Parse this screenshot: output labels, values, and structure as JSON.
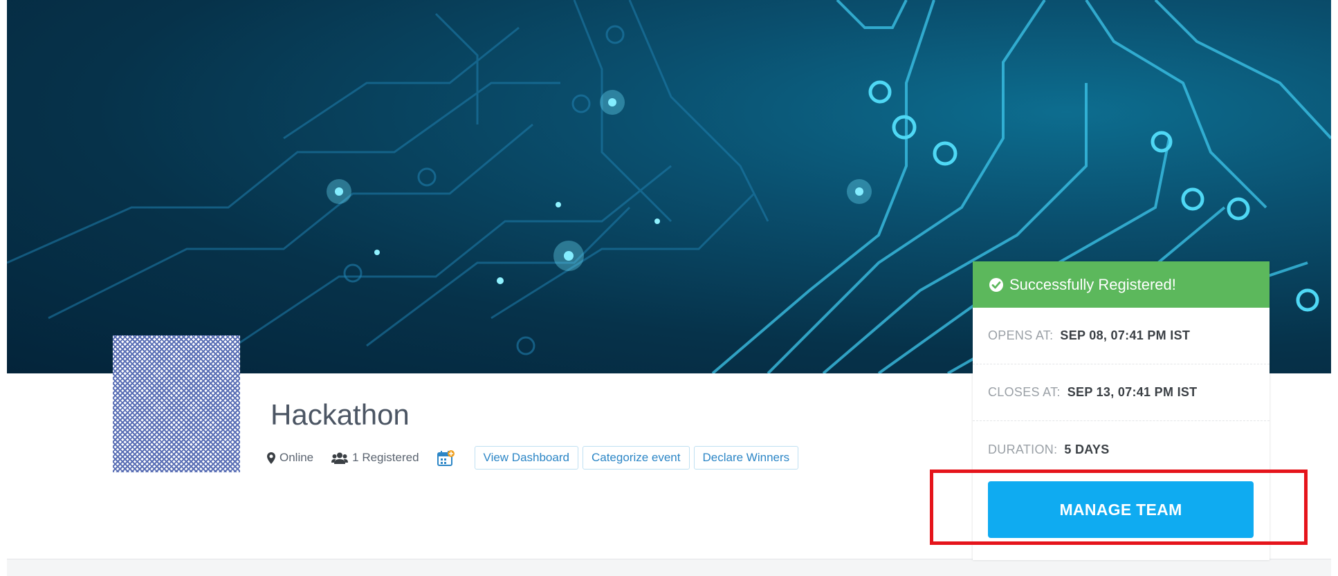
{
  "event": {
    "title": "Hackathon",
    "location": "Online",
    "registered": "1 Registered"
  },
  "actions": {
    "view_dashboard": "View Dashboard",
    "categorize_event": "Categorize event",
    "declare_winners": "Declare Winners"
  },
  "registration": {
    "status": "Successfully Registered!",
    "opens_label": "OPENS AT:",
    "opens_value": "SEP 08, 07:41 PM IST",
    "closes_label": "CLOSES AT:",
    "closes_value": "SEP 13, 07:41 PM IST",
    "duration_label": "DURATION:",
    "duration_value": "5 DAYS",
    "manage_button": "MANAGE TEAM"
  },
  "icons": {
    "location": "map-marker-icon",
    "registered": "users-icon",
    "calendar": "calendar-icon",
    "status": "check-circle-icon"
  },
  "colors": {
    "success": "#5cb85c",
    "primary_button": "#0fabf1",
    "link": "#2c86c6",
    "highlight": "#e5141b"
  }
}
